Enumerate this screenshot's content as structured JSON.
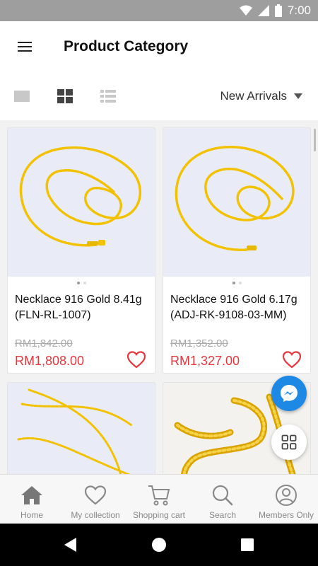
{
  "status_bar": {
    "time": "7:00"
  },
  "app_bar": {
    "title": "Product Category"
  },
  "toolbar": {
    "sort_label": "New Arrivals"
  },
  "products": [
    {
      "name": "Necklace 916 Gold 8.41g (FLN-RL-1007)",
      "old_price": "RM1,842.00",
      "price": "RM1,808.00",
      "image": "gold-chain-necklace"
    },
    {
      "name": "Necklace 916 Gold 6.17g (ADJ-RK-9108-03-MM)",
      "old_price": "RM1,352.00",
      "price": "RM1,327.00",
      "image": "gold-chain-necklace"
    },
    {
      "name": "",
      "old_price": "",
      "price": "",
      "image": "gold-chain-necklace"
    },
    {
      "name": "",
      "old_price": "",
      "price": "",
      "image": "gold-rope-chain"
    }
  ],
  "bottom_nav": [
    {
      "label": "Home",
      "icon": "home-icon"
    },
    {
      "label": "My collection",
      "icon": "heart-icon"
    },
    {
      "label": "Shopping cart",
      "icon": "cart-icon"
    },
    {
      "label": "Search",
      "icon": "search-icon"
    },
    {
      "label": "Members Only",
      "icon": "user-icon"
    }
  ],
  "colors": {
    "accent_red": "#e8363d",
    "messenger_blue": "#1e88e5",
    "status_bar": "#9e9e9e",
    "gold": "#f2c200"
  }
}
